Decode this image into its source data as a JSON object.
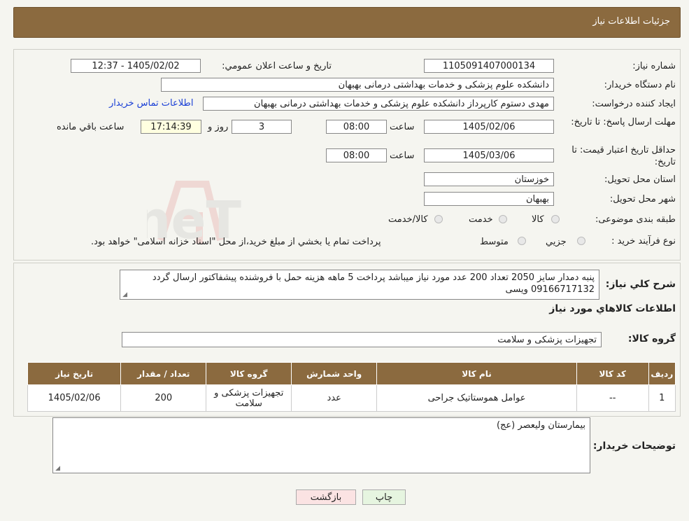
{
  "header": {
    "title": "جزئیات اطلاعات نیاز"
  },
  "form": {
    "need_number_label": "شماره نیاز:",
    "need_number": "1105091407000134",
    "announce_label": "تاریخ و ساعت اعلان عمومي:",
    "announce_value": "1405/02/02 - 12:37",
    "buyer_org_label": "نام دستگاه خريدار:",
    "buyer_org": "دانشکده علوم پزشکی و خدمات بهداشتی  درمانی بهبهان",
    "creator_label": "ایجاد کننده درخواست:",
    "creator": "مهدی دستوم کارپرداز دانشکده علوم پزشکی و خدمات بهداشتی  درمانی بهبهان",
    "contact_link": "اطلاعات تماس خریدار",
    "deadline_label": "مهلت ارسال پاسخ: تا تاریخ:",
    "deadline_date": "1405/02/06",
    "time_label": "ساعت",
    "deadline_time": "08:00",
    "days_value": "3",
    "days_label": "روز و",
    "remaining_time": "17:14:39",
    "remaining_label": "ساعت باقي مانده",
    "price_validity_label": "حداقل تاريخ اعتبار قيمت: تا تاریخ:",
    "price_validity_date": "1405/03/06",
    "price_validity_time": "08:00",
    "province_label": "استان محل تحویل:",
    "province": "خوزستان",
    "city_label": "شهر محل تحویل:",
    "city": "بهبهان",
    "category_label": "طبقه بندی موضوعی:",
    "category_options": [
      "کالا",
      "خدمت",
      "کالا/خدمت"
    ],
    "process_label": "نوع فرآیند خرید :",
    "process_options": [
      "جزيي",
      "متوسط"
    ],
    "process_note": "پرداخت تمام يا بخشي از مبلغ خريد،از محل \"اسناد خزانه اسلامی\" خواهد بود."
  },
  "description": {
    "label": "شرح کلي نياز:",
    "text": "پنبه دمدار سایز 2050 تعداد 200 عدد مورد نیاز میباشد پرداخت 5 ماهه هزینه حمل با فروشنده پیشفاکتور ارسال گردد 09166717132 ویسی"
  },
  "goods": {
    "section_title": "اطلاعات کالاهاي مورد نياز",
    "group_label": "گروه کالا:",
    "group_value": "تجهیزات پزشکی و سلامت",
    "columns": [
      "ردیف",
      "کد کالا",
      "نام کالا",
      "واحد شمارش",
      "گروه کالا",
      "تعداد / مقدار",
      "تاریخ نیاز"
    ],
    "rows": [
      [
        "1",
        "--",
        "عوامل هموستاتیک جراحی",
        "عدد",
        "تجهیزات پزشکی و سلامت",
        "200",
        "1405/02/06"
      ]
    ]
  },
  "buyer_notes": {
    "label": "توضیحات خریدار:",
    "text": "بیمارستان ولیعصر (عج)"
  },
  "buttons": {
    "print": "چاپ",
    "back": "بازگشت"
  },
  "watermark": {
    "text": "AriaTender.neT"
  },
  "colors": {
    "header_bg": "#8b6a3f",
    "link": "#1a3fd6",
    "print_btn": "#e6f5e0",
    "back_btn": "#fbe3e3"
  }
}
